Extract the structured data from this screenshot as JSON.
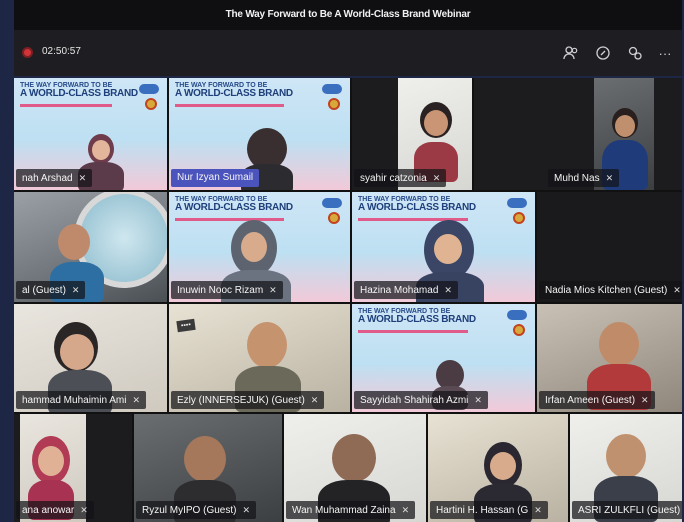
{
  "window": {
    "title": "The Way Forward to Be A World-Class Brand Webinar"
  },
  "toolbar": {
    "recording_timer": "02:50:57",
    "icons": [
      "people-icon",
      "chat-icon",
      "raise-hand-icon",
      "more-icon"
    ],
    "more_glyph": "···"
  },
  "slide": {
    "line1": "THE WAY FORWARD TO BE",
    "line2": "A WORLD-CLASS BRAND"
  },
  "participants": [
    {
      "name": "nah Arshad"
    },
    {
      "name": "Nur Izyan Sumail"
    },
    {
      "name": "syahir catzonia"
    },
    {
      "name": "Muhd Nas"
    },
    {
      "name": "al (Guest)"
    },
    {
      "name": "Inuwin Nooc Rizam"
    },
    {
      "name": "Hazina Mohamad"
    },
    {
      "name": "Nadia Mios Kitchen (Guest)"
    },
    {
      "name": "hammad Muhaimin Ami"
    },
    {
      "name": "Ezly (INNERSEJUK) (Guest)"
    },
    {
      "name": "Sayyidah Shahirah Azmi"
    },
    {
      "name": "Irfan Ameen (Guest)"
    },
    {
      "name": "ana anowar"
    },
    {
      "name": "Ryzul MyIPO (Guest)"
    },
    {
      "name": "Wan Muhammad Zaina"
    },
    {
      "name": "Hartini H. Hassan (G"
    },
    {
      "name": "ASRI ZULKFLI (Guest)"
    }
  ],
  "colors": {
    "accent": "#4b53bc",
    "record": "#d13438",
    "background": "#1d2745"
  }
}
